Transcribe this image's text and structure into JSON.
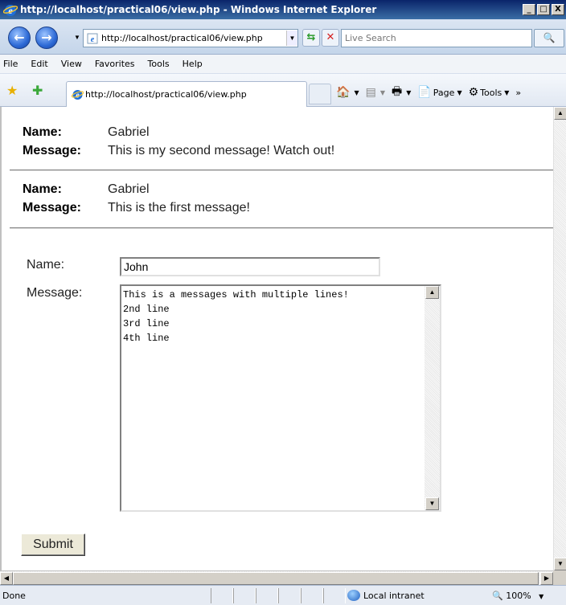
{
  "window": {
    "title": "http://localhost/practical06/view.php - Windows Internet Explorer",
    "controls": [
      "_",
      "□",
      "X"
    ]
  },
  "nav": {
    "back_glyph": "←",
    "forward_glyph": "→",
    "url": "http://localhost/practical06/view.php",
    "search_placeholder": "Live Search"
  },
  "menu": {
    "items": [
      "File",
      "Edit",
      "View",
      "Favorites",
      "Tools",
      "Help"
    ]
  },
  "tabs": {
    "active_tab": "http://localhost/practical06/view.php"
  },
  "command_bar": {
    "page_label": "Page",
    "tools_label": "Tools",
    "overflow": "»"
  },
  "messages": [
    {
      "name_label": "Name:",
      "name": "Gabriel",
      "message_label": "Message:",
      "message": "This is my second message! Watch out!"
    },
    {
      "name_label": "Name:",
      "name": "Gabriel",
      "message_label": "Message:",
      "message": "This is the first message!"
    }
  ],
  "form": {
    "name_label": "Name:",
    "name_value": "John",
    "message_label": "Message:",
    "message_value": "This is a messages with multiple lines!\n2nd line\n3rd line\n4th line",
    "submit_label": "Submit"
  },
  "status": {
    "text": "Done",
    "zone": "Local intranet",
    "zoom": "100%"
  }
}
